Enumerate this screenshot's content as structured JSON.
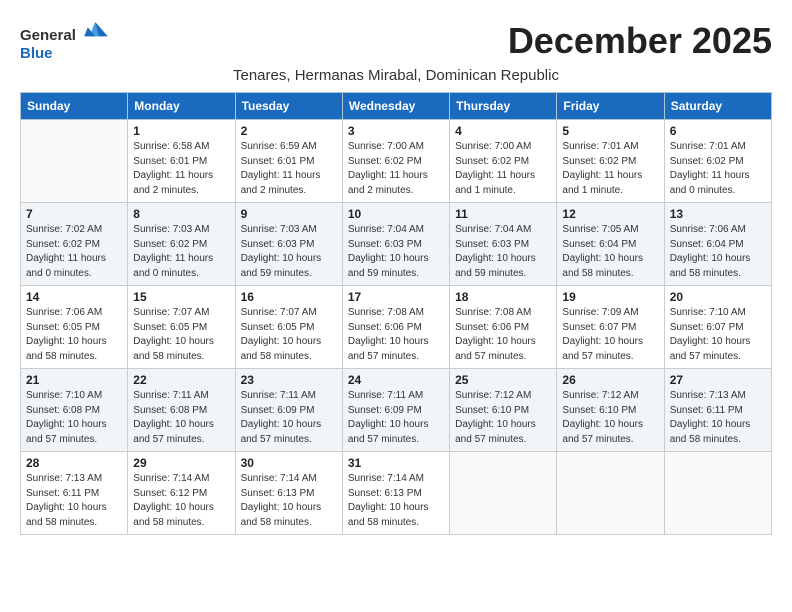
{
  "logo": {
    "general": "General",
    "blue": "Blue"
  },
  "title": "December 2025",
  "subtitle": "Tenares, Hermanas Mirabal, Dominican Republic",
  "weekdays": [
    "Sunday",
    "Monday",
    "Tuesday",
    "Wednesday",
    "Thursday",
    "Friday",
    "Saturday"
  ],
  "weeks": [
    [
      {
        "day": "",
        "info": ""
      },
      {
        "day": "1",
        "info": "Sunrise: 6:58 AM\nSunset: 6:01 PM\nDaylight: 11 hours and 2 minutes."
      },
      {
        "day": "2",
        "info": "Sunrise: 6:59 AM\nSunset: 6:01 PM\nDaylight: 11 hours and 2 minutes."
      },
      {
        "day": "3",
        "info": "Sunrise: 7:00 AM\nSunset: 6:02 PM\nDaylight: 11 hours and 2 minutes."
      },
      {
        "day": "4",
        "info": "Sunrise: 7:00 AM\nSunset: 6:02 PM\nDaylight: 11 hours and 1 minute."
      },
      {
        "day": "5",
        "info": "Sunrise: 7:01 AM\nSunset: 6:02 PM\nDaylight: 11 hours and 1 minute."
      },
      {
        "day": "6",
        "info": "Sunrise: 7:01 AM\nSunset: 6:02 PM\nDaylight: 11 hours and 0 minutes."
      }
    ],
    [
      {
        "day": "7",
        "info": "Sunrise: 7:02 AM\nSunset: 6:02 PM\nDaylight: 11 hours and 0 minutes."
      },
      {
        "day": "8",
        "info": "Sunrise: 7:03 AM\nSunset: 6:02 PM\nDaylight: 11 hours and 0 minutes."
      },
      {
        "day": "9",
        "info": "Sunrise: 7:03 AM\nSunset: 6:03 PM\nDaylight: 10 hours and 59 minutes."
      },
      {
        "day": "10",
        "info": "Sunrise: 7:04 AM\nSunset: 6:03 PM\nDaylight: 10 hours and 59 minutes."
      },
      {
        "day": "11",
        "info": "Sunrise: 7:04 AM\nSunset: 6:03 PM\nDaylight: 10 hours and 59 minutes."
      },
      {
        "day": "12",
        "info": "Sunrise: 7:05 AM\nSunset: 6:04 PM\nDaylight: 10 hours and 58 minutes."
      },
      {
        "day": "13",
        "info": "Sunrise: 7:06 AM\nSunset: 6:04 PM\nDaylight: 10 hours and 58 minutes."
      }
    ],
    [
      {
        "day": "14",
        "info": "Sunrise: 7:06 AM\nSunset: 6:05 PM\nDaylight: 10 hours and 58 minutes."
      },
      {
        "day": "15",
        "info": "Sunrise: 7:07 AM\nSunset: 6:05 PM\nDaylight: 10 hours and 58 minutes."
      },
      {
        "day": "16",
        "info": "Sunrise: 7:07 AM\nSunset: 6:05 PM\nDaylight: 10 hours and 58 minutes."
      },
      {
        "day": "17",
        "info": "Sunrise: 7:08 AM\nSunset: 6:06 PM\nDaylight: 10 hours and 57 minutes."
      },
      {
        "day": "18",
        "info": "Sunrise: 7:08 AM\nSunset: 6:06 PM\nDaylight: 10 hours and 57 minutes."
      },
      {
        "day": "19",
        "info": "Sunrise: 7:09 AM\nSunset: 6:07 PM\nDaylight: 10 hours and 57 minutes."
      },
      {
        "day": "20",
        "info": "Sunrise: 7:10 AM\nSunset: 6:07 PM\nDaylight: 10 hours and 57 minutes."
      }
    ],
    [
      {
        "day": "21",
        "info": "Sunrise: 7:10 AM\nSunset: 6:08 PM\nDaylight: 10 hours and 57 minutes."
      },
      {
        "day": "22",
        "info": "Sunrise: 7:11 AM\nSunset: 6:08 PM\nDaylight: 10 hours and 57 minutes."
      },
      {
        "day": "23",
        "info": "Sunrise: 7:11 AM\nSunset: 6:09 PM\nDaylight: 10 hours and 57 minutes."
      },
      {
        "day": "24",
        "info": "Sunrise: 7:11 AM\nSunset: 6:09 PM\nDaylight: 10 hours and 57 minutes."
      },
      {
        "day": "25",
        "info": "Sunrise: 7:12 AM\nSunset: 6:10 PM\nDaylight: 10 hours and 57 minutes."
      },
      {
        "day": "26",
        "info": "Sunrise: 7:12 AM\nSunset: 6:10 PM\nDaylight: 10 hours and 57 minutes."
      },
      {
        "day": "27",
        "info": "Sunrise: 7:13 AM\nSunset: 6:11 PM\nDaylight: 10 hours and 58 minutes."
      }
    ],
    [
      {
        "day": "28",
        "info": "Sunrise: 7:13 AM\nSunset: 6:11 PM\nDaylight: 10 hours and 58 minutes."
      },
      {
        "day": "29",
        "info": "Sunrise: 7:14 AM\nSunset: 6:12 PM\nDaylight: 10 hours and 58 minutes."
      },
      {
        "day": "30",
        "info": "Sunrise: 7:14 AM\nSunset: 6:13 PM\nDaylight: 10 hours and 58 minutes."
      },
      {
        "day": "31",
        "info": "Sunrise: 7:14 AM\nSunset: 6:13 PM\nDaylight: 10 hours and 58 minutes."
      },
      {
        "day": "",
        "info": ""
      },
      {
        "day": "",
        "info": ""
      },
      {
        "day": "",
        "info": ""
      }
    ]
  ]
}
